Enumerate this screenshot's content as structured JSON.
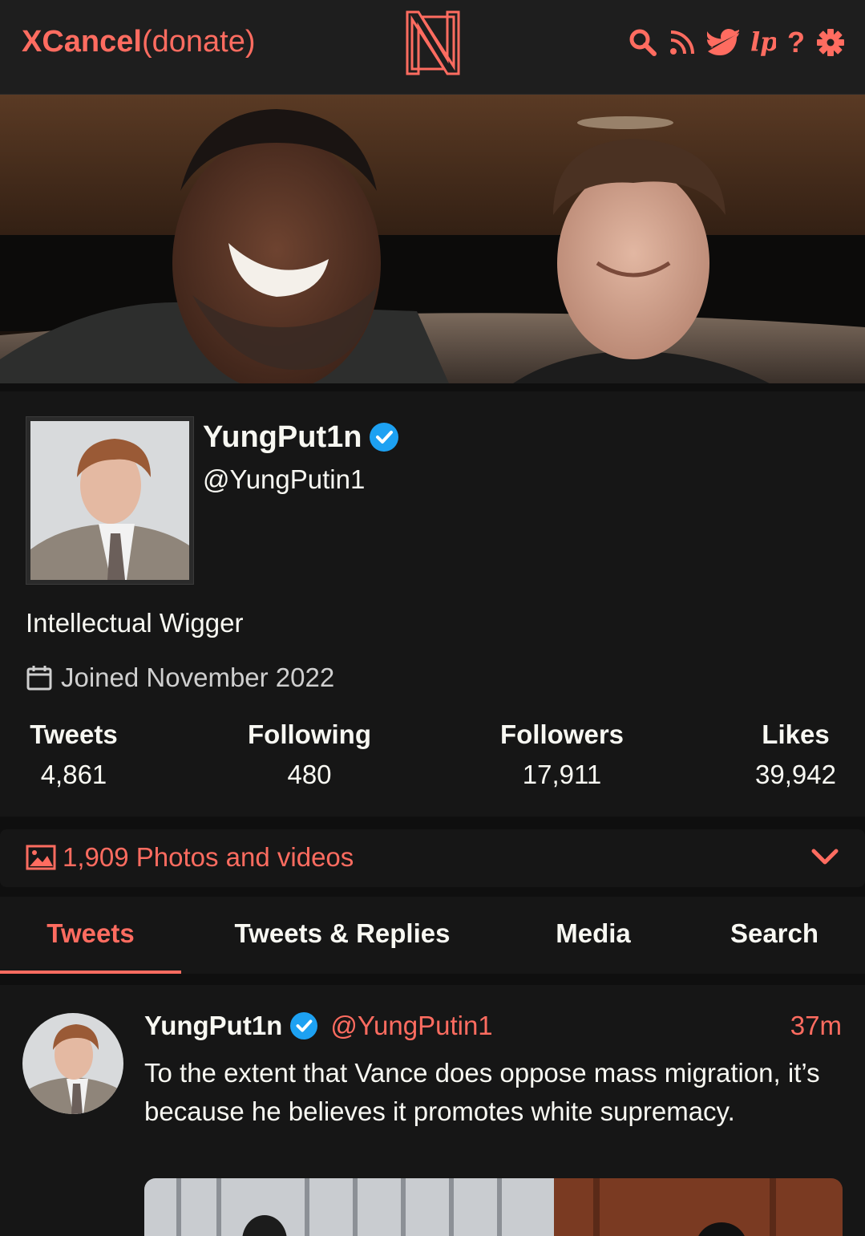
{
  "navbar": {
    "brand_bold": "XCancel",
    "brand_normal": "(donate)",
    "icons": [
      "search-icon",
      "rss-icon",
      "twitter-icon",
      "liberapay-icon",
      "help-icon",
      "settings-icon"
    ],
    "help_glyph": "?"
  },
  "profile": {
    "fullname": "YungPut1n",
    "username": "@YungPutin1",
    "verified": true,
    "bio": "Intellectual Wigger",
    "joined": "Joined November 2022",
    "stats": [
      {
        "label": "Tweets",
        "value": "4,861"
      },
      {
        "label": "Following",
        "value": "480"
      },
      {
        "label": "Followers",
        "value": "17,911"
      },
      {
        "label": "Likes",
        "value": "39,942"
      }
    ]
  },
  "photo_rail": {
    "label": "1,909 Photos and videos"
  },
  "tabs": [
    {
      "label": "Tweets",
      "active": true
    },
    {
      "label": "Tweets & Replies",
      "active": false
    },
    {
      "label": "Media",
      "active": false
    },
    {
      "label": "Search",
      "active": false
    }
  ],
  "tweet": {
    "fullname": "YungPut1n",
    "username": "@YungPutin1",
    "date": "37m",
    "text": "To the extent that Vance does oppose mass migration, it’s because he believes it promotes white supremacy."
  },
  "colors": {
    "accent": "#ff6c60",
    "background": "#0f0f0f",
    "card": "#161616",
    "verified": "#1da1f2"
  }
}
